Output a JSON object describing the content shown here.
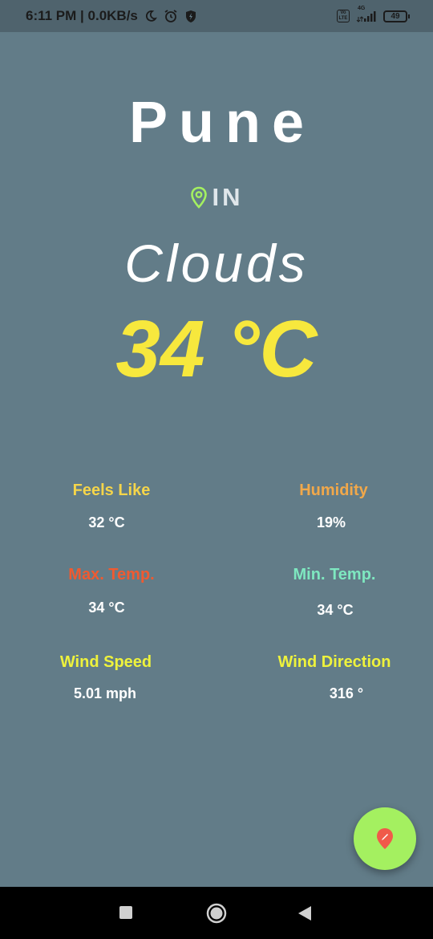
{
  "status_bar": {
    "time_speed": "6:11 PM | 0.0KB/s",
    "volte": "Vo LTE",
    "network": "4G",
    "battery": "49"
  },
  "weather": {
    "city": "Pune",
    "country": "IN",
    "condition": "Clouds",
    "temperature": "34 °C"
  },
  "details": {
    "feels_like": {
      "label": "Feels Like",
      "value": "32 °C",
      "color": "#f5d54a"
    },
    "humidity": {
      "label": "Humidity",
      "value": "19%",
      "color": "#f1a84a"
    },
    "max_temp": {
      "label": "Max. Temp.",
      "value": "34 °C",
      "color": "#f05a30"
    },
    "min_temp": {
      "label": "Min. Temp.",
      "value": "34 °C",
      "color": "#7ee8c0"
    },
    "wind_speed": {
      "label": "Wind Speed",
      "value": "5.01 mph",
      "color": "#eef23c"
    },
    "wind_direction": {
      "label": "Wind Direction",
      "value": "316 °",
      "color": "#eef23c"
    }
  },
  "icons": {
    "location_pin": "location-pin-icon",
    "fab_icon": "location-edit-icon",
    "nav_recents": "square-icon",
    "nav_home": "circle-icon",
    "nav_back": "back-triangle-icon"
  },
  "colors": {
    "background": "#627c88",
    "temperature": "#f7e83d",
    "fab": "#a4f060",
    "pin": "#a4f060"
  }
}
